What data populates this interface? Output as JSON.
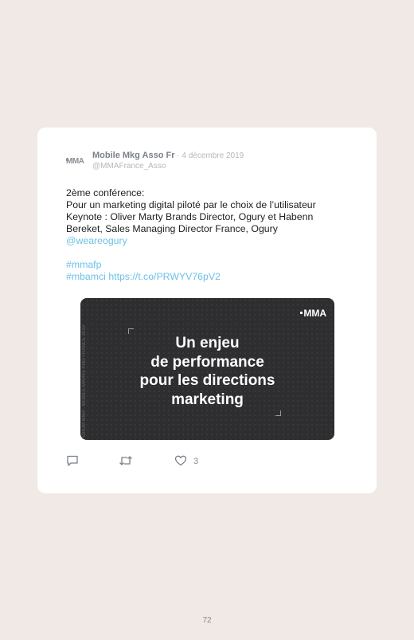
{
  "tweet": {
    "avatar_text": "MMA",
    "display_name": "Mobile Mkg Asso Fr",
    "date": " · 4 décembre 2019",
    "handle": "@MMAFrance_Asso",
    "lines": [
      "2ème conférence:",
      "Pour un marketing digital piloté par le choix de l’utilisateur",
      "Keynote : Oliver Marty Brands Director, Ogury et Habenn",
      "Bereket, Sales Managing Director France, Ogury"
    ],
    "mention": "@weareogury",
    "hashtag1": "#mmafp",
    "hashtag2": "#mbamci",
    "url": "https://t.co/PRWYV76pV2",
    "like_count": "3"
  },
  "media": {
    "logo": "MMA",
    "side_text": "FORUM MMA - MOBILE MARKETING FRANCE 2019",
    "headline": [
      "Un enjeu",
      "de performance",
      "pour les directions",
      "marketing"
    ]
  },
  "icons": [
    "reply-icon",
    "retweet-icon",
    "heart-icon"
  ],
  "colors": {
    "link": "#6cc1e6",
    "background": "#f0e9e6",
    "media_bg": "#2e2e30"
  },
  "page_number": "72"
}
